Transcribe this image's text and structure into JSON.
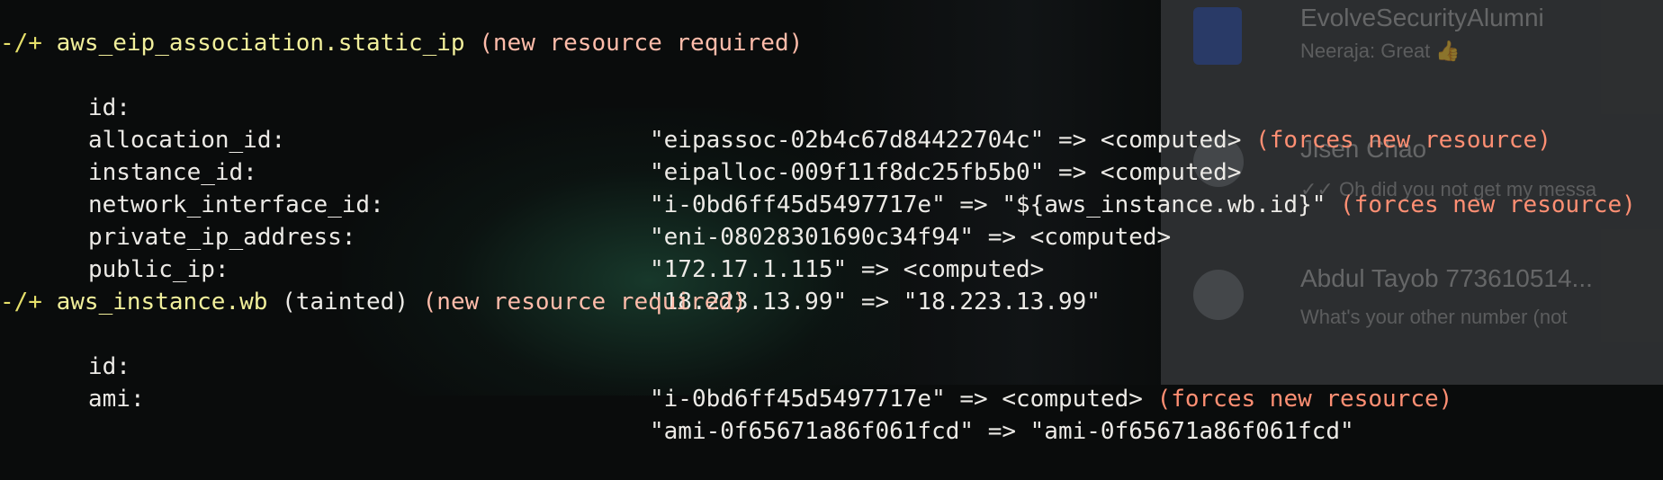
{
  "background": {
    "chat": {
      "items": [
        {
          "name": "EvolveSecurityAlumni",
          "preview": "Neeraja: Great 👍"
        },
        {
          "name": "Jisen Chao",
          "preview": "✓✓ Oh did you not get my messa"
        },
        {
          "name": "Abdul Tayob 773610514...",
          "preview": "What's your other number (not"
        }
      ]
    }
  },
  "terminal": {
    "blocks": [
      {
        "prefix": "-/+",
        "resource": "aws_eip_association.static_ip",
        "tainted": "",
        "required": "(new resource required)",
        "attrs": [
          {
            "key": "id:",
            "old": "\"eipassoc-02b4c67d84422704c\"",
            "arrow": "=>",
            "new": "<computed>",
            "note": "(forces new resource)"
          },
          {
            "key": "allocation_id:",
            "old": "\"eipalloc-009f11f8dc25fb5b0\"",
            "arrow": "=>",
            "new": "<computed>",
            "note": ""
          },
          {
            "key": "instance_id:",
            "old": "\"i-0bd6ff45d5497717e\"",
            "arrow": "=>",
            "new": "\"${aws_instance.wb.id}\"",
            "note": "(forces new resource)"
          },
          {
            "key": "network_interface_id:",
            "old": "\"eni-08028301690c34f94\"",
            "arrow": "=>",
            "new": "<computed>",
            "note": ""
          },
          {
            "key": "private_ip_address:",
            "old": "\"172.17.1.115\"",
            "arrow": "=>",
            "new": "<computed>",
            "note": ""
          },
          {
            "key": "public_ip:",
            "old": "\"18.223.13.99\"",
            "arrow": "=>",
            "new": "\"18.223.13.99\"",
            "note": ""
          }
        ]
      },
      {
        "prefix": "-/+",
        "resource": "aws_instance.wb",
        "tainted": "(tainted)",
        "required": "(new resource required)",
        "attrs": [
          {
            "key": "id:",
            "old": "\"i-0bd6ff45d5497717e\"",
            "arrow": "=>",
            "new": "<computed>",
            "note": "(forces new resource)"
          },
          {
            "key": "ami:",
            "old": "\"ami-0f65671a86f061fcd\"",
            "arrow": "=>",
            "new": "\"ami-0f65671a86f061fcd\"",
            "note": ""
          }
        ]
      }
    ]
  }
}
